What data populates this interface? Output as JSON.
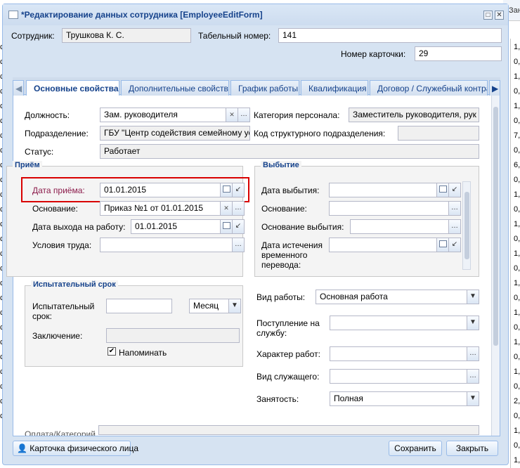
{
  "background": {
    "top_label": "Зан",
    "right_col": [
      "1,",
      "0,",
      "1,",
      "0,",
      "1,",
      "0,",
      "7,",
      "0,",
      "6,",
      "0,",
      "1,",
      "0,",
      "1,",
      "0,",
      "1,",
      "0,",
      "1,",
      "0,",
      "1,",
      "0,",
      "1,",
      "0,",
      "1,",
      "0,",
      "2,",
      "0,",
      "1,",
      "0,",
      "1,"
    ],
    "left_col": [
      "с",
      "с",
      "с",
      "с",
      "с",
      "с",
      "с",
      "с",
      "с",
      "с",
      "с",
      "с",
      "с",
      "с",
      "с",
      "с",
      "с",
      "с",
      "с",
      "с",
      "с",
      "с",
      "с",
      "с",
      "с",
      "с"
    ]
  },
  "window": {
    "title": "*Редактирование данных сотрудника [EmployeeEditForm]"
  },
  "header": {
    "employee_label": "Сотрудник:",
    "employee_value": "Трушкова К. С.",
    "tab_number_label": "Табельный номер:",
    "tab_number_value": "141",
    "card_number_label": "Номер карточки:",
    "card_number_value": "29"
  },
  "tabs": [
    "Основные свойства",
    "Дополнительные свойства",
    "График работы",
    "Квалификация",
    "Договор / Служебный контракт"
  ],
  "main": {
    "position_label": "Должность:",
    "position_value": "Зам. руководителя",
    "category_label": "Категория персонала:",
    "category_value": "Заместитель руководителя, рук",
    "department_label": "Подразделение:",
    "department_value": "ГБУ \"Центр содействия семейному ус",
    "dept_code_label": "Код структурного подразделения:",
    "dept_code_value": "",
    "status_label": "Статус:",
    "status_value": "Работает"
  },
  "hire": {
    "legend": "Приём",
    "date_label": "Дата приёма:",
    "date_value": "01.01.2015",
    "basis_label": "Основание:",
    "basis_value": "Приказ №1 от 01.01.2015",
    "start_label": "Дата выхода на работу:",
    "start_value": "01.01.2015",
    "conditions_label": "Условия труда:",
    "conditions_value": ""
  },
  "leave": {
    "legend": "Выбытие",
    "date_label": "Дата выбытия:",
    "basis_label": "Основание:",
    "reason_label": "Основание выбытия:",
    "transfer_label_1": "Дата истечения",
    "transfer_label_2": "временного",
    "transfer_label_3": "перевода:"
  },
  "probation": {
    "legend": "Испытательный срок",
    "term_label_1": "Испытательный",
    "term_label_2": "срок:",
    "term_value": "",
    "unit_value": "Месяц",
    "conclusion_label": "Заключение:",
    "remind_label": "Напоминать",
    "remind_checked": true
  },
  "work": {
    "type_label": "Вид работы:",
    "type_value": "Основная работа",
    "entry_label_1": "Поступление на",
    "entry_label_2": "службу:",
    "nature_label": "Характер работ:",
    "servant_label": "Вид служащего:",
    "employment_label": "Занятость:",
    "employment_value": "Полная",
    "cutoff_label": "Оплата/Категорий"
  },
  "footer": {
    "card_button": "Карточка физического лица",
    "save_button": "Сохранить",
    "close_button": "Закрыть"
  }
}
